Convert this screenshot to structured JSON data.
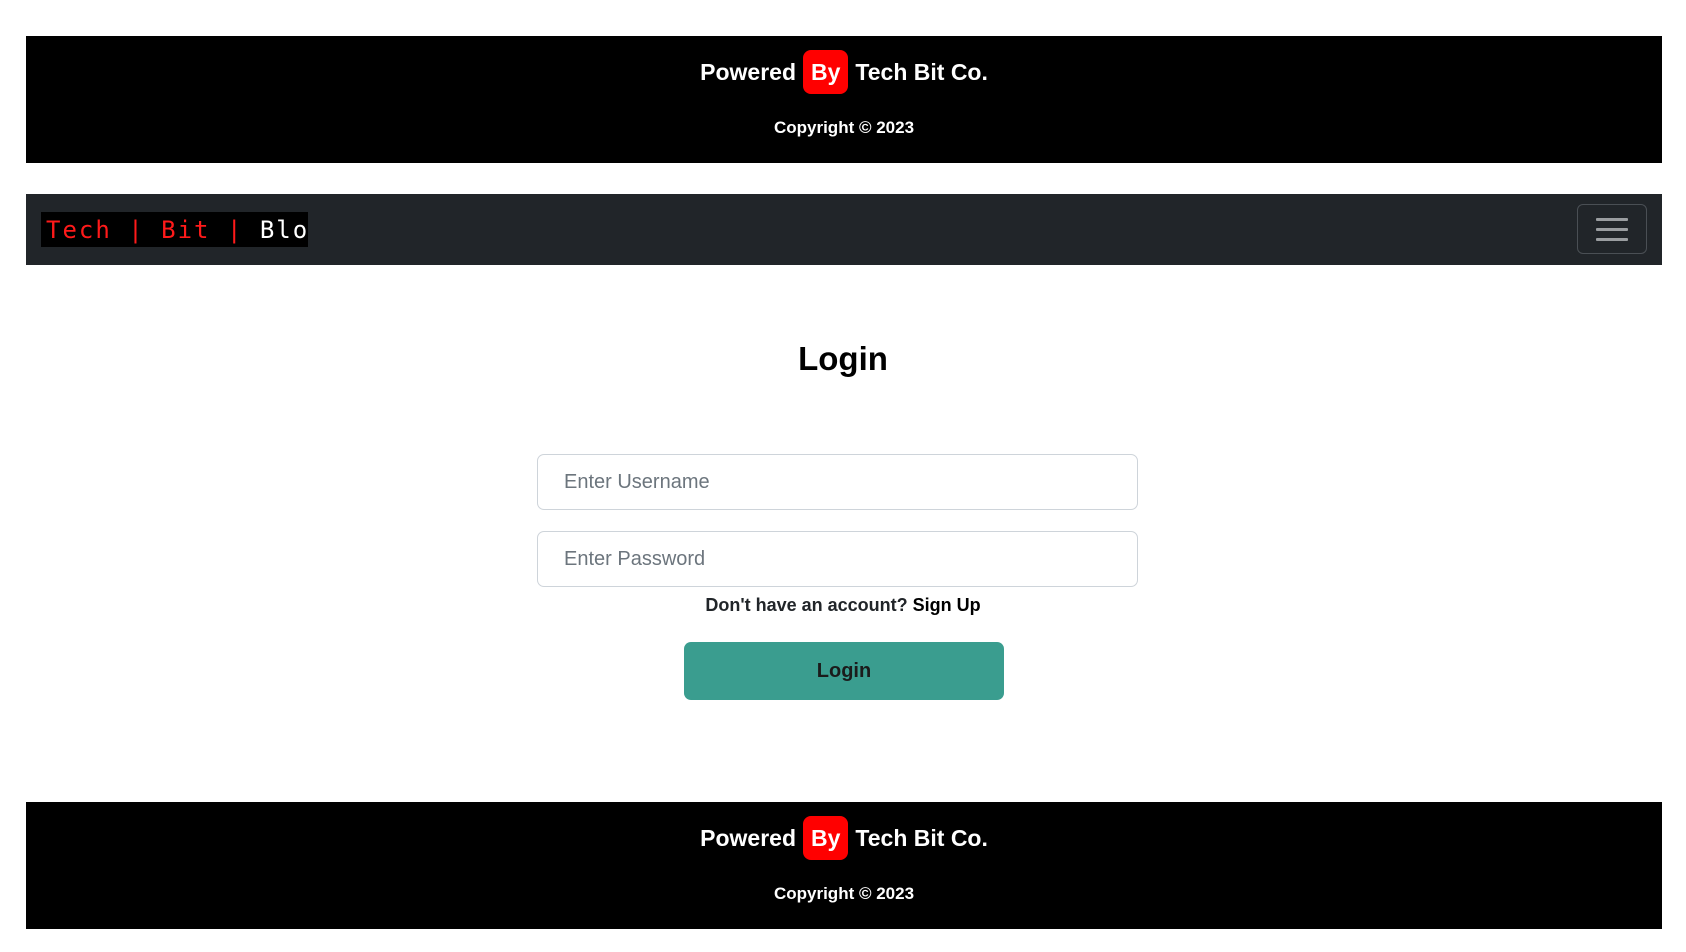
{
  "footer": {
    "powered_label": "Powered",
    "by_label": "By",
    "company": "Tech Bit Co.",
    "copyright": "Copyright © 2023"
  },
  "navbar": {
    "brand": {
      "part1": "Tech | Bit | ",
      "part2": "Blog"
    },
    "toggler_icon": "hamburger-menu-icon"
  },
  "login": {
    "title": "Login",
    "username_placeholder": "Enter Username",
    "password_placeholder": "Enter Password",
    "no_account_text": "Don't have an account? ",
    "signup_label": "Sign Up",
    "button_label": "Login"
  },
  "colors": {
    "footer_bg": "#000000",
    "by_badge": "#ff0000",
    "navbar_bg": "#212529",
    "brand_red": "#ff1a1a",
    "login_button": "#3a9d8f"
  }
}
